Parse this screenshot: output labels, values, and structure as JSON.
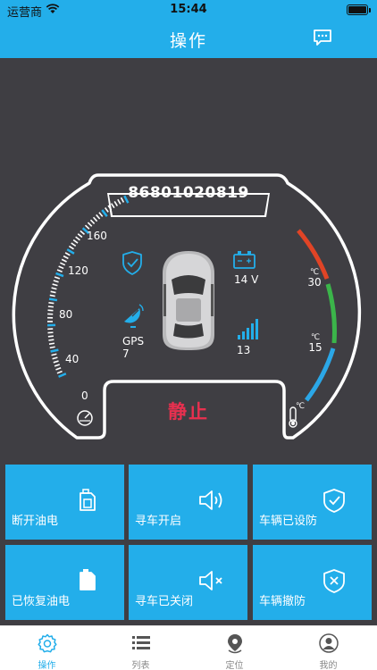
{
  "status_bar": {
    "carrier": "运营商",
    "time": "15:44",
    "battery_level": 1.0
  },
  "nav": {
    "title": "操作",
    "message_icon": "message-icon"
  },
  "dashboard": {
    "device_id": "86801020819",
    "speed_scale": [
      "160",
      "120",
      "80",
      "40",
      "0"
    ],
    "temp_labels": [
      {
        "unit": "℃",
        "value": "30"
      },
      {
        "unit": "℃",
        "value": "15"
      },
      {
        "unit": "℃",
        "value": ""
      }
    ],
    "voltage": "14 V",
    "gps": {
      "label": "GPS",
      "count": "7"
    },
    "signal": "13",
    "state": "静止",
    "colors": {
      "state": "#e8304f",
      "temp_hot": "#e04426",
      "temp_mid": "#3bb54a",
      "temp_cold": "#2ba7e7",
      "accent": "#23aeea"
    }
  },
  "actions": [
    {
      "label": "断开油电",
      "icon": "fuel-cut-icon"
    },
    {
      "label": "寻车开启",
      "icon": "speaker-on-icon"
    },
    {
      "label": "车辆已设防",
      "icon": "shield-check-icon"
    },
    {
      "label": "已恢复油电",
      "icon": "fuel-restore-icon"
    },
    {
      "label": "寻车已关闭",
      "icon": "speaker-off-icon"
    },
    {
      "label": "车辆撤防",
      "icon": "shield-x-icon"
    }
  ],
  "tabs": [
    {
      "label": "操作",
      "icon": "gear-icon",
      "active": true
    },
    {
      "label": "列表",
      "icon": "list-icon",
      "active": false
    },
    {
      "label": "定位",
      "icon": "location-pin-icon",
      "active": false
    },
    {
      "label": "我的",
      "icon": "user-icon",
      "active": false
    }
  ]
}
